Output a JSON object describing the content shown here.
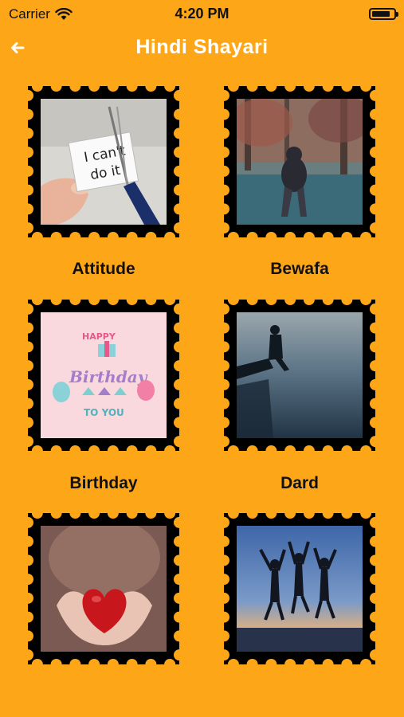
{
  "status_bar": {
    "carrier": "Carrier",
    "time": "4:20 PM"
  },
  "header": {
    "back_icon": "arrow-left-icon",
    "title": "Hindi Shayari"
  },
  "colors": {
    "background": "#FDA718",
    "stamp_frame": "#000000",
    "title": "#FFFFFF"
  },
  "categories": [
    {
      "label": "Attitude",
      "image": "hand-holding-i-cant-do-it-note-cut-by-scissors",
      "note_line1": "I can't",
      "note_line2": "do it"
    },
    {
      "label": "Bewafa",
      "image": "sad-person-sitting-in-autumn-park"
    },
    {
      "label": "Birthday",
      "image": "happy-birthday-card",
      "card_line1": "HAPPY",
      "card_line2": "Birthday",
      "card_line3": "TO YOU"
    },
    {
      "label": "Dard",
      "image": "silhouette-sitting-on-pier-at-dusk"
    },
    {
      "label": "",
      "image": "hands-holding-red-heart"
    },
    {
      "label": "",
      "image": "silhouettes-jumping-at-sunset"
    }
  ]
}
